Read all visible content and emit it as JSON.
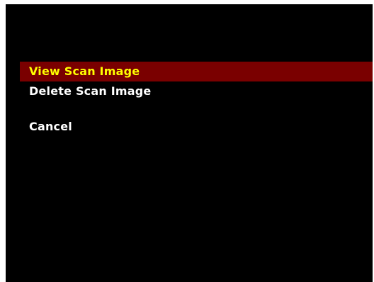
{
  "menu": {
    "items": [
      {
        "label": "View Scan Image",
        "selected": true
      },
      {
        "label": "Delete Scan Image",
        "selected": false
      },
      {
        "label": "Cancel",
        "selected": false
      }
    ]
  },
  "colors": {
    "background": "#000000",
    "highlight_bg": "#7a0000",
    "highlight_text": "#ffff00",
    "text": "#ffffff"
  }
}
